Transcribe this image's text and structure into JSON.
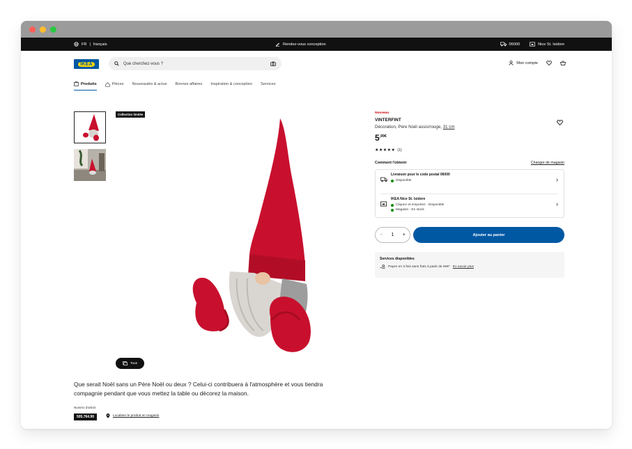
{
  "topbar": {
    "lang_code": "FR",
    "lang_name": "français",
    "promo": "Rendez-vous conception",
    "postal_code": "06000",
    "store": "Nice St. Isidore"
  },
  "header": {
    "logo_text": "IKEA",
    "search_placeholder": "Que cherchez-vous ?",
    "account_label": "Mon compte"
  },
  "nav": {
    "items": [
      {
        "label": "Produits"
      },
      {
        "label": "Pièces"
      },
      {
        "label": "Nouveautés & actus"
      },
      {
        "label": "Bonnes affaires"
      },
      {
        "label": "Inspiration & conception"
      },
      {
        "label": "Services"
      }
    ]
  },
  "gallery": {
    "badge": "Collection limitée",
    "zoom_label": "Tous"
  },
  "product": {
    "new_label": "Nouveau",
    "name": "VINTERFINT",
    "subtitle": "Décoration, Père Noël assis/rouge,",
    "size": "31 cm",
    "price_int": "5",
    "price_dec": ",99€",
    "stars": "★★★★★",
    "review_count": "(1)",
    "description": "Que serait Noël sans un Père Noël ou deux ? Celui-ci contribuera à l'atmosphère et vous tiendra compagnie pendant que vous mettez la table ou décorez la maison.",
    "article_label": "Numéro d'article",
    "article_number": "505.764.90",
    "locate_label": "Localiser le produit en magasin"
  },
  "obtain": {
    "heading": "Comment l'obtenir",
    "change_store": "Changer de magasin",
    "delivery_title": "Livraison pour le code postal 06000",
    "delivery_status": "Disponible",
    "store_title": "IKEA Nice St. Isidore",
    "store_status1": "Cliquez et emportez - Disponible",
    "store_status2": "Magasin - En stock"
  },
  "cart": {
    "quantity": "1",
    "add_label": "Ajouter au panier"
  },
  "services": {
    "heading": "Services disponibles",
    "text": "Payez en 3 fois sans frais à partir de 90€*",
    "link": "En savoir plus"
  },
  "colors": {
    "brand_blue": "#0058a3",
    "brand_yellow": "#ffdb00",
    "gnome_red": "#c8102e",
    "available_green": "#0a8a00",
    "new_red": "#cc0008"
  }
}
